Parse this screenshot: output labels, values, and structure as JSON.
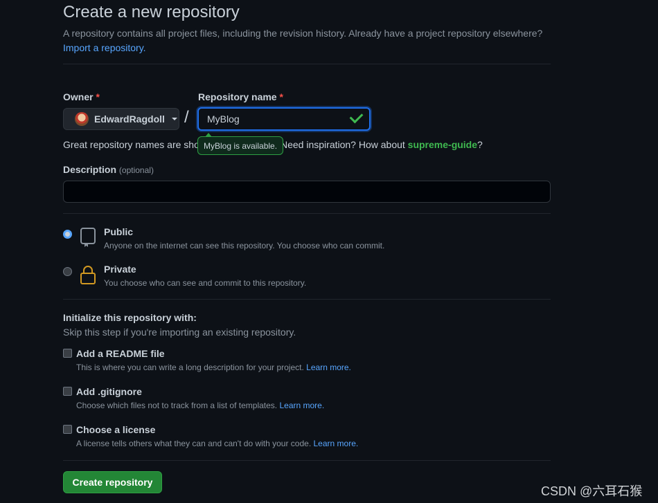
{
  "header": {
    "title": "Create a new repository",
    "subtitle": "A repository contains all project files, including the revision history. Already have a project repository elsewhere?",
    "import_link": "Import a repository."
  },
  "owner": {
    "label": "Owner",
    "required_mark": "*",
    "name": "EdwardRagdoll"
  },
  "separator": "/",
  "repository_name": {
    "label": "Repository name",
    "required_mark": "*",
    "value": "MyBlog",
    "tooltip": "MyBlog is available."
  },
  "hint": {
    "prefix": "Great repository names are sho",
    "middle": "Need inspiration? How about ",
    "suggestion": "supreme-guide",
    "suffix": "?"
  },
  "description": {
    "label": "Description",
    "optional": "(optional)",
    "value": ""
  },
  "visibility": [
    {
      "title": "Public",
      "description": "Anyone on the internet can see this repository. You choose who can commit.",
      "selected": true,
      "icon": "repo-icon"
    },
    {
      "title": "Private",
      "description": "You choose who can see and commit to this repository.",
      "selected": false,
      "icon": "lock-icon"
    }
  ],
  "initialize": {
    "title": "Initialize this repository with:",
    "subtitle": "Skip this step if you're importing an existing repository.",
    "options": [
      {
        "title": "Add a README file",
        "description": "This is where you can write a long description for your project.",
        "link": "Learn more.",
        "checked": false
      },
      {
        "title": "Add .gitignore",
        "description": "Choose which files not to track from a list of templates.",
        "link": "Learn more.",
        "checked": false
      },
      {
        "title": "Choose a license",
        "description": "A license tells others what they can and can't do with your code.",
        "link": "Learn more.",
        "checked": false
      }
    ]
  },
  "create_button": "Create repository",
  "watermark": "CSDN @六耳石猴",
  "colors": {
    "background": "#0d1117",
    "accent": "#1f6feb",
    "success": "#238636",
    "link": "#58a6ff",
    "danger": "#f85149"
  }
}
